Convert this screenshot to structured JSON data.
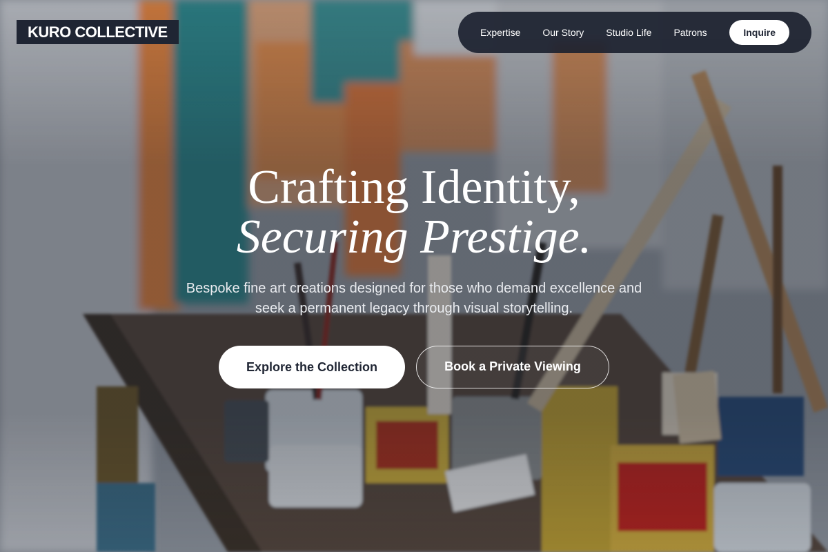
{
  "brand": {
    "logo_text": "KURO COLLECTIVE"
  },
  "nav": {
    "links": [
      "Expertise",
      "Our Story",
      "Studio Life",
      "Patrons"
    ],
    "cta_label": "Inquire"
  },
  "hero": {
    "headline_line1": "Crafting Identity,",
    "headline_line2": "Securing Prestige.",
    "subtext": "Bespoke fine art creations designed for those who demand excellence and seek a permanent legacy through visual storytelling.",
    "primary_button": "Explore the Collection",
    "secondary_button": "Book a Private Viewing",
    "background_image": "artist-studio-paint-brushes-and-cans"
  },
  "colors": {
    "navy": "#1f2533",
    "white": "#ffffff"
  }
}
